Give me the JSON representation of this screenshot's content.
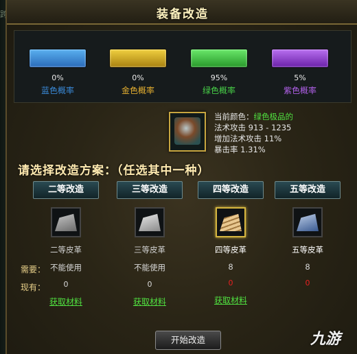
{
  "window": {
    "title": "装备改造"
  },
  "background": {
    "left_text": "跨程"
  },
  "probabilities": [
    {
      "pct": "0%",
      "label": "蓝色概率",
      "color": "#3a8ad8",
      "label_color": "#3a8ad8"
    },
    {
      "pct": "0%",
      "label": "金色概率",
      "color": "#d6b028",
      "label_color": "#e6b030"
    },
    {
      "pct": "95%",
      "label": "绿色概率",
      "color": "#48c848",
      "label_color": "#48d048"
    },
    {
      "pct": "5%",
      "label": "紫色概率",
      "color": "#9a3ad8",
      "label_color": "#b060e8"
    }
  ],
  "item_stats": {
    "color_label": "当前颜色：",
    "color_value": "绿色极品的",
    "line2": "法术攻击 913 - 1235",
    "line3": "增加法术攻击 11%",
    "line4": "暴击率  1.31%"
  },
  "prompt": "请选择改造方案：（任选其中一种）",
  "row_labels": {
    "need": "需要：",
    "have": "现有："
  },
  "options": [
    {
      "button": "二等改造",
      "material": "二等皮革",
      "status": "不能使用",
      "have": "0",
      "get": "获取材料",
      "leather_color": "#9a9a9a",
      "name_color": "#cfcfcf",
      "have_color": "#d8d8d8"
    },
    {
      "button": "三等改造",
      "material": "三等皮革",
      "status": "不能使用",
      "have": "0",
      "get": "获取材料",
      "leather_color": "#cfcfcf",
      "name_color": "#cfcfcf",
      "have_color": "#d8d8d8"
    },
    {
      "button": "四等改造",
      "material": "四等皮革",
      "status": "8",
      "have": "0",
      "get": "获取材料",
      "leather_color": "#d6b07a",
      "name_color": "#ffffff",
      "have_color": "#e82020"
    },
    {
      "button": "五等改造",
      "material": "五等皮革",
      "status": "8",
      "have": "0",
      "get": "",
      "leather_color": "#7a9ac8",
      "name_color": "#ffffff",
      "have_color": "#e82020"
    }
  ],
  "start_button": "开始改造",
  "watermark": "九游"
}
